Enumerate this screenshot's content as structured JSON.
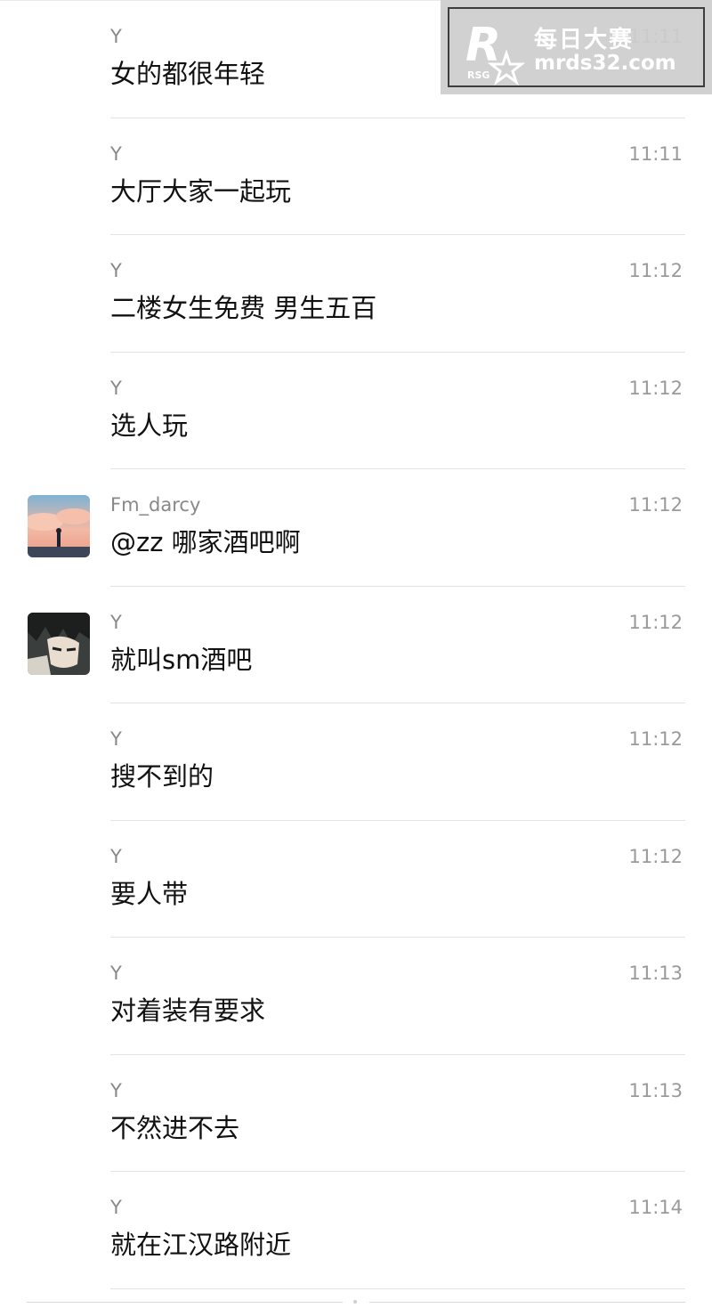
{
  "messages": [
    {
      "sender": "Y",
      "time": "11:11",
      "text": "女的都很年轻",
      "avatar": ""
    },
    {
      "sender": "Y",
      "time": "11:11",
      "text": "大厅大家一起玩",
      "avatar": ""
    },
    {
      "sender": "Y",
      "time": "11:12",
      "text": "二楼女生免费 男生五百",
      "avatar": ""
    },
    {
      "sender": "Y",
      "time": "11:12",
      "text": "选人玩",
      "avatar": ""
    },
    {
      "sender": "Fm_darcy",
      "time": "11:12",
      "text": "@zz 哪家酒吧啊",
      "avatar": "sky-avatar-icon"
    },
    {
      "sender": "Y",
      "time": "11:12",
      "text": "就叫sm酒吧",
      "avatar": "anime-avatar-icon"
    },
    {
      "sender": "Y",
      "time": "11:12",
      "text": "搜不到的",
      "avatar": ""
    },
    {
      "sender": "Y",
      "time": "11:12",
      "text": "要人带",
      "avatar": ""
    },
    {
      "sender": "Y",
      "time": "11:13",
      "text": "对着装有要求",
      "avatar": ""
    },
    {
      "sender": "Y",
      "time": "11:13",
      "text": "不然进不去",
      "avatar": ""
    },
    {
      "sender": "Y",
      "time": "11:14",
      "text": "就在江汉路附近",
      "avatar": ""
    }
  ],
  "watermark": {
    "logo_text": "R",
    "logo_sub": "RSG",
    "line1": "每日大赛",
    "line2": "mrds32.com"
  },
  "colors": {
    "text": "#111111",
    "meta": "#888888",
    "divider": "#e3e3e3",
    "watermark_bg": "#cdcdcd"
  }
}
